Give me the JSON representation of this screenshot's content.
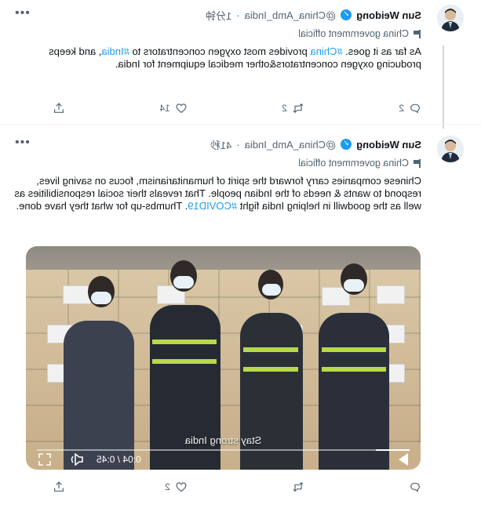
{
  "tweets": [
    {
      "author_name": "Sun Weidong",
      "verified_icon": "verified-badge",
      "handle": "@China_Amb_India",
      "separator": "·",
      "time": "1分钟",
      "label": "China government official",
      "text_parts": [
        {
          "text": "As far as it goes. "
        },
        {
          "text": "#China",
          "hashtag": true
        },
        {
          "text": " provides most oxygen concentrators to "
        },
        {
          "text": "#India",
          "hashtag": true
        },
        {
          "text": ", and keeps producing oxygen concentrators&other medical equipment for India."
        }
      ],
      "actions": {
        "reply": "2",
        "retweet": "2",
        "like": "14",
        "share": ""
      }
    },
    {
      "author_name": "Sun Weidong",
      "verified_icon": "verified-badge",
      "handle": "@China_Amb_India",
      "separator": "·",
      "time": "41秒",
      "label": "China government official",
      "text_parts": [
        {
          "text": "Chinese companies carry forward the spirit of humanitarianism,  focus on saving lives, respond to  wants & needs of the Indian people. That reveals their social responsibilities as well as the goodwill in helping India fight "
        },
        {
          "text": "#COVID19",
          "hashtag": true
        },
        {
          "text": ". Thumbs-up for what they have done."
        }
      ],
      "video": {
        "caption": "Stay strong India",
        "time": "0:04 / 0:45",
        "progress": 0.09
      },
      "actions": {
        "reply": "",
        "retweet": "",
        "like": "2",
        "share": ""
      }
    }
  ],
  "colors": {
    "accent": "#1d9bf0",
    "muted": "#536471",
    "text": "#0f1419"
  },
  "icons": [
    "more-icon",
    "flag-icon",
    "reply-icon",
    "retweet-icon",
    "like-icon",
    "share-icon",
    "play-icon",
    "volume-icon",
    "fullscreen-icon"
  ]
}
